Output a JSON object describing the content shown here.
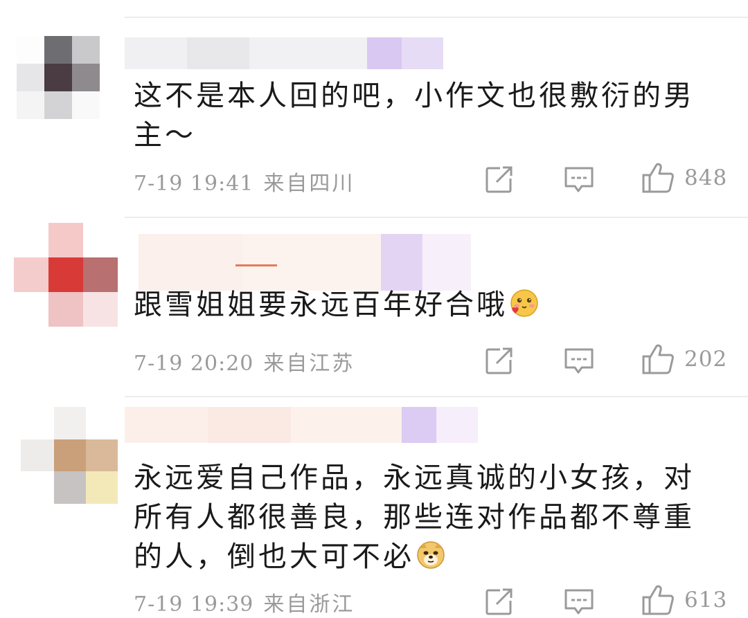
{
  "comments": [
    {
      "text": "这不是本人回的吧，小作文也很敷衍的男主～",
      "time": "7-19 19:41",
      "location": "来自四川",
      "likes": "848",
      "emoji": ""
    },
    {
      "text": "跟雪姐姐要永远百年好合哦",
      "time": "7-19 20:20",
      "location": "来自江苏",
      "likes": "202",
      "emoji": "blush-heart-emoji"
    },
    {
      "text": "永远爱自己作品，永远真诚的小女孩，对所有人都很善良，那些连对作品都不尊重的人，倒也大可不必",
      "time": "7-19 19:39",
      "location": "来自浙江",
      "likes": "613",
      "emoji": "doge-emoji"
    }
  ],
  "icons": {
    "share": "share-icon",
    "reply": "comment-icon",
    "like": "thumbs-up-icon"
  },
  "colors": {
    "meta_gray": "#9a9a9a",
    "text": "#1a1a1a",
    "divider": "#ececf0",
    "name_highlight": "#d9c8f2"
  }
}
